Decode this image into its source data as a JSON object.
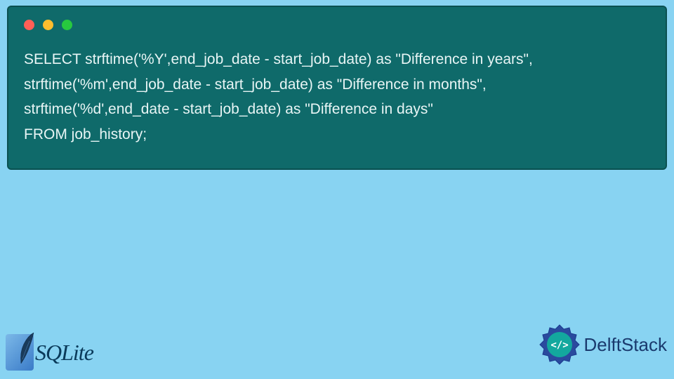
{
  "code": {
    "line1": "SELECT strftime('%Y',end_job_date - start_job_date) as \"Difference in years\",",
    "line2": "strftime('%m',end_job_date - start_job_date) as \"Difference in months\",",
    "line3": "strftime('%d',end_date - start_job_date) as \"Difference in days\"",
    "line4": "FROM job_history;"
  },
  "logos": {
    "sqlite": "SQLite",
    "delft": "DelftStack"
  }
}
